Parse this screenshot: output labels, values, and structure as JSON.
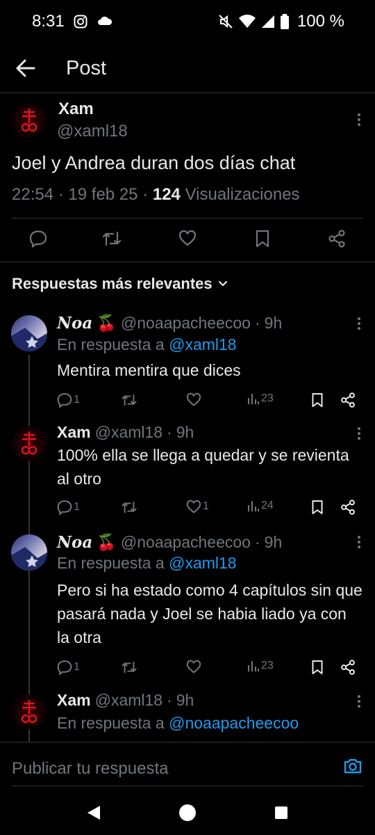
{
  "status_bar": {
    "time": "8:31",
    "battery": "100 %",
    "icons": [
      "instagram-icon",
      "cloud-icon",
      "mute-icon",
      "wifi-icon",
      "signal-icon",
      "battery-icon"
    ]
  },
  "header": {
    "title": "Post"
  },
  "post": {
    "name": "Xam",
    "handle": "@xaml18",
    "text": "Joel y Andrea duran dos días chat",
    "time": "22:54",
    "date": "19 feb 25",
    "views_count": "124",
    "views_label": "Visualizaciones"
  },
  "sort_label": "Respuestas más relevantes",
  "replies": [
    {
      "name": "Noa",
      "emoji": "🍒",
      "handle": "@noaapacheecoo",
      "age": "9h",
      "reply_prefix": "En respuesta a",
      "reply_to": "@xaml18",
      "text": "Mentira mentira que dices",
      "replies": "1",
      "likes": "",
      "views": "23"
    },
    {
      "name": "Xam",
      "emoji": "",
      "handle": "@xaml18",
      "age": "9h",
      "reply_prefix": "",
      "reply_to": "",
      "text": "100% ella se llega a quedar y se revienta al otro",
      "replies": "1",
      "likes": "1",
      "views": "24"
    },
    {
      "name": "Noa",
      "emoji": "🍒",
      "handle": "@noaapacheecoo",
      "age": "9h",
      "reply_prefix": "En respuesta a",
      "reply_to": "@xaml18",
      "text": "Pero si ha estado como 4 capítulos sin que pasará nada y  Joel  se habia liado  ya con la otra",
      "replies": "1",
      "likes": "",
      "views": "23"
    },
    {
      "name": "Xam",
      "emoji": "",
      "handle": "@xaml18",
      "age": "9h",
      "reply_prefix": "En respuesta a",
      "reply_to": "@noaapacheecoo",
      "text": "",
      "replies": "",
      "likes": "",
      "views": ""
    }
  ],
  "compose": {
    "placeholder": "Publicar tu respuesta"
  },
  "colors": {
    "background": "#000000",
    "text": "#e7e9ea",
    "muted": "#71767b",
    "link": "#1d9bf0",
    "divider": "#2f3336",
    "logo_red": "#e0141e"
  }
}
